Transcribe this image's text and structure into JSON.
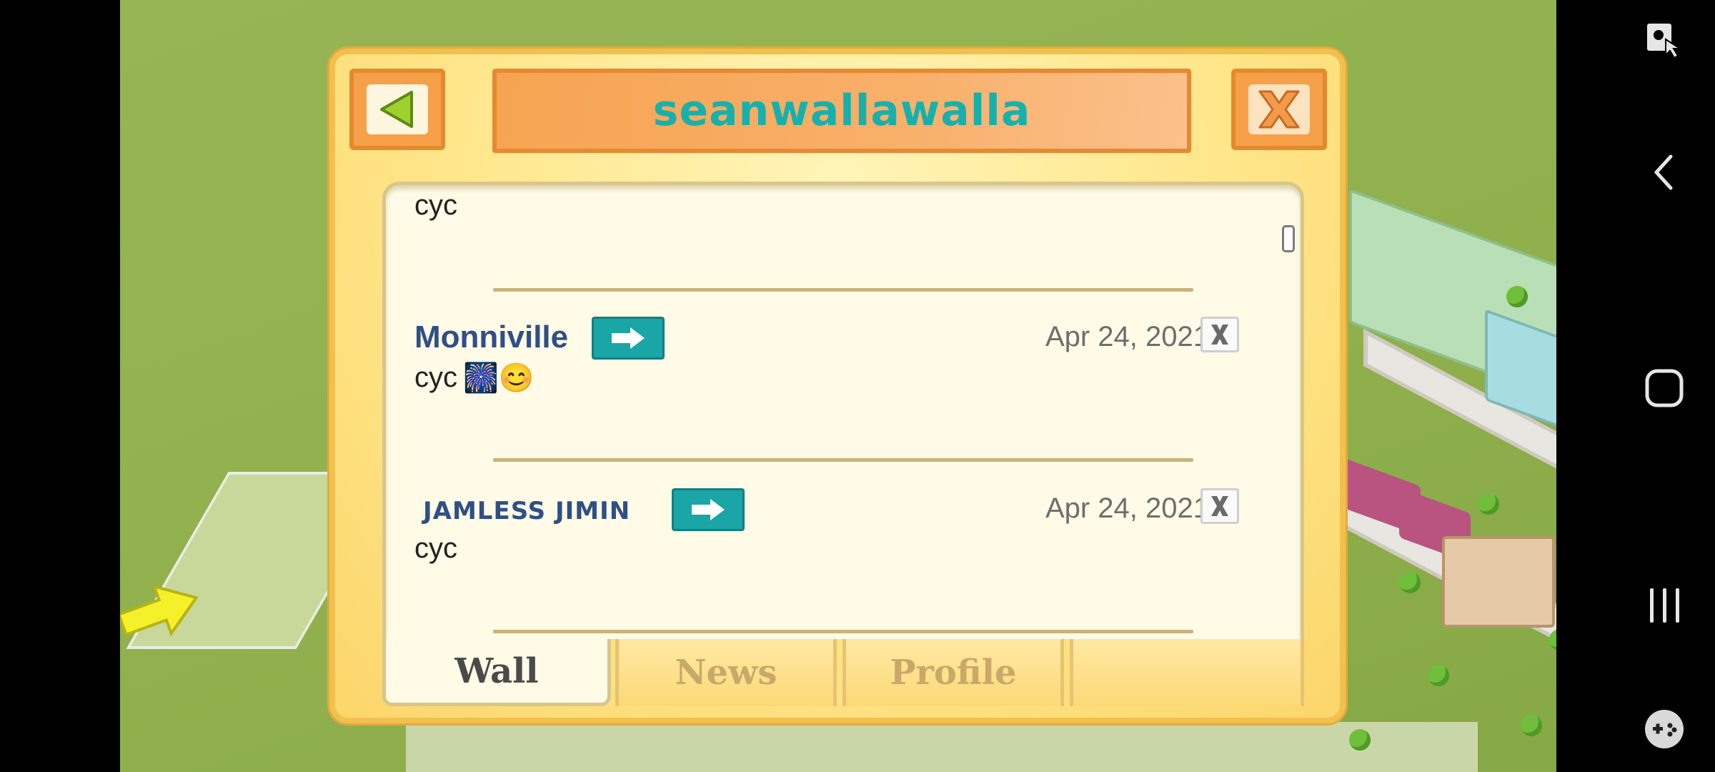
{
  "dialog": {
    "title": "seanwallawalla",
    "back_icon": "back-arrow-icon",
    "close_icon": "close-x-icon",
    "colors": {
      "title": "#17b1ad",
      "name": "#2f4f86",
      "frame": "#ffe68a"
    }
  },
  "wall": {
    "fragment_text": "cyc",
    "posts": [
      {
        "author": "Monniville",
        "date": "Apr 24, 2021",
        "text": "cyc",
        "emoji": "🎆😊"
      },
      {
        "author": "JAMLESS JIMIN",
        "date": "Apr 24, 2021",
        "text": "cyc",
        "emoji": ""
      }
    ]
  },
  "tabs": [
    {
      "label": "Wall",
      "active": true
    },
    {
      "label": "News",
      "active": false
    },
    {
      "label": "Profile",
      "active": false
    },
    {
      "label": "",
      "active": false
    }
  ],
  "system_nav": {
    "icons": [
      "screen-pin-icon",
      "back-nav-icon",
      "home-nav-icon",
      "recents-nav-icon",
      "game-tools-icon"
    ]
  }
}
